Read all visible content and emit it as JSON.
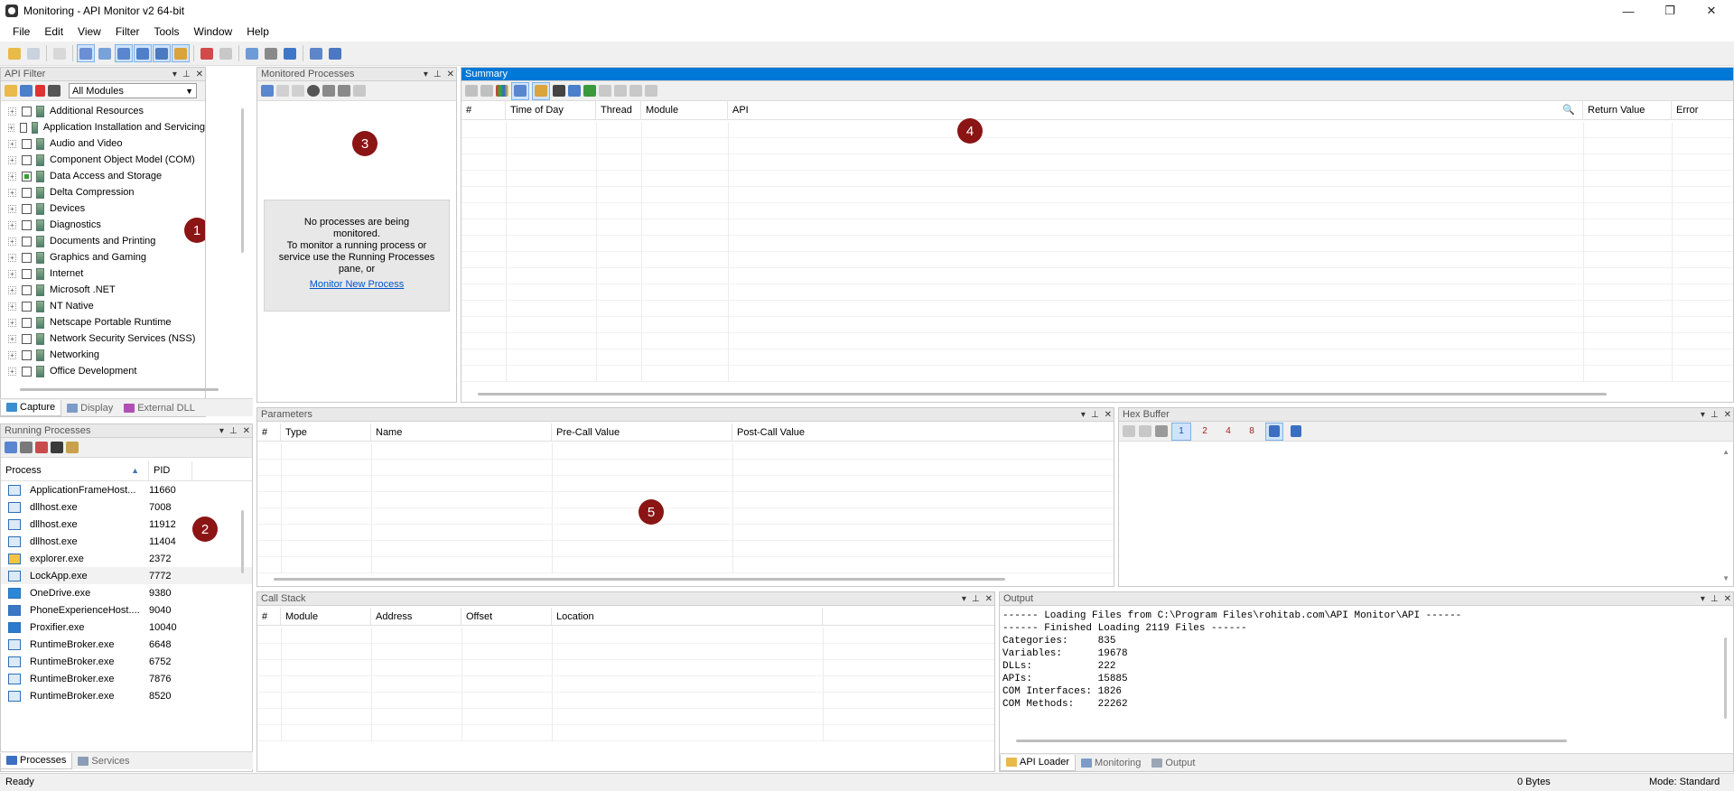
{
  "window": {
    "title": "Monitoring - API Monitor v2 64-bit",
    "minimize": "—",
    "restore": "❐",
    "close": "✕"
  },
  "menu": [
    "File",
    "Edit",
    "View",
    "Filter",
    "Tools",
    "Window",
    "Help"
  ],
  "api_filter": {
    "title": "API Filter",
    "module_select": "All Modules",
    "items": [
      {
        "label": "Additional Resources",
        "checked": "none"
      },
      {
        "label": "Application Installation and Servicing",
        "checked": "none"
      },
      {
        "label": "Audio and Video",
        "checked": "none"
      },
      {
        "label": "Component Object Model (COM)",
        "checked": "none"
      },
      {
        "label": "Data Access and Storage",
        "checked": "partial"
      },
      {
        "label": "Delta Compression",
        "checked": "none"
      },
      {
        "label": "Devices",
        "checked": "none"
      },
      {
        "label": "Diagnostics",
        "checked": "none"
      },
      {
        "label": "Documents and Printing",
        "checked": "none"
      },
      {
        "label": "Graphics and Gaming",
        "checked": "none"
      },
      {
        "label": "Internet",
        "checked": "none"
      },
      {
        "label": "Microsoft .NET",
        "checked": "none"
      },
      {
        "label": "NT Native",
        "checked": "none"
      },
      {
        "label": "Netscape Portable Runtime",
        "checked": "none"
      },
      {
        "label": "Network Security Services (NSS)",
        "checked": "none"
      },
      {
        "label": "Networking",
        "checked": "none"
      },
      {
        "label": "Office Development",
        "checked": "none"
      }
    ],
    "tabs": [
      "Capture",
      "Display",
      "External DLL"
    ],
    "badge": "1"
  },
  "running_processes": {
    "title": "Running Processes",
    "columns": [
      "Process",
      "PID"
    ],
    "rows": [
      {
        "name": "ApplicationFrameHost...",
        "pid": "11660"
      },
      {
        "name": "dllhost.exe",
        "pid": "7008"
      },
      {
        "name": "dllhost.exe",
        "pid": "11912"
      },
      {
        "name": "dllhost.exe",
        "pid": "11404"
      },
      {
        "name": "explorer.exe",
        "pid": "2372"
      },
      {
        "name": "LockApp.exe",
        "pid": "7772"
      },
      {
        "name": "OneDrive.exe",
        "pid": "9380"
      },
      {
        "name": "PhoneExperienceHost....",
        "pid": "9040"
      },
      {
        "name": "Proxifier.exe",
        "pid": "10040"
      },
      {
        "name": "RuntimeBroker.exe",
        "pid": "6648"
      },
      {
        "name": "RuntimeBroker.exe",
        "pid": "6752"
      },
      {
        "name": "RuntimeBroker.exe",
        "pid": "7876"
      },
      {
        "name": "RuntimeBroker.exe",
        "pid": "8520"
      }
    ],
    "tabs": [
      "Processes",
      "Services"
    ],
    "badge": "2"
  },
  "monitored_processes": {
    "title": "Monitored Processes",
    "message_line1": "No processes are being monitored.",
    "message_line2": "To monitor a running process or service use the Running Processes pane, or",
    "link": "Monitor New Process",
    "badge": "3"
  },
  "summary": {
    "title": "Summary",
    "columns": [
      "#",
      "Time of Day",
      "Thread",
      "Module",
      "API",
      "Return Value",
      "Error"
    ],
    "badge": "4"
  },
  "parameters": {
    "title": "Parameters",
    "columns": [
      "#",
      "Type",
      "Name",
      "Pre-Call Value",
      "Post-Call Value"
    ],
    "badge": "5"
  },
  "hex_buffer": {
    "title": "Hex Buffer",
    "sizes": [
      "1",
      "2",
      "4",
      "8"
    ]
  },
  "call_stack": {
    "title": "Call Stack",
    "columns": [
      "#",
      "Module",
      "Address",
      "Offset",
      "Location"
    ]
  },
  "output": {
    "title": "Output",
    "lines": [
      "------ Loading Files from C:\\Program Files\\rohitab.com\\API Monitor\\API ------",
      "------ Finished Loading 2119 Files ------",
      "Categories:     835",
      "Variables:      19678",
      "DLLs:           222",
      "APIs:           15885",
      "COM Interfaces: 1826",
      "COM Methods:    22262"
    ],
    "tabs": [
      "API Loader",
      "Monitoring",
      "Output"
    ]
  },
  "status": {
    "left": "Ready",
    "bytes": "0 Bytes",
    "mode": "Mode: Standard"
  }
}
